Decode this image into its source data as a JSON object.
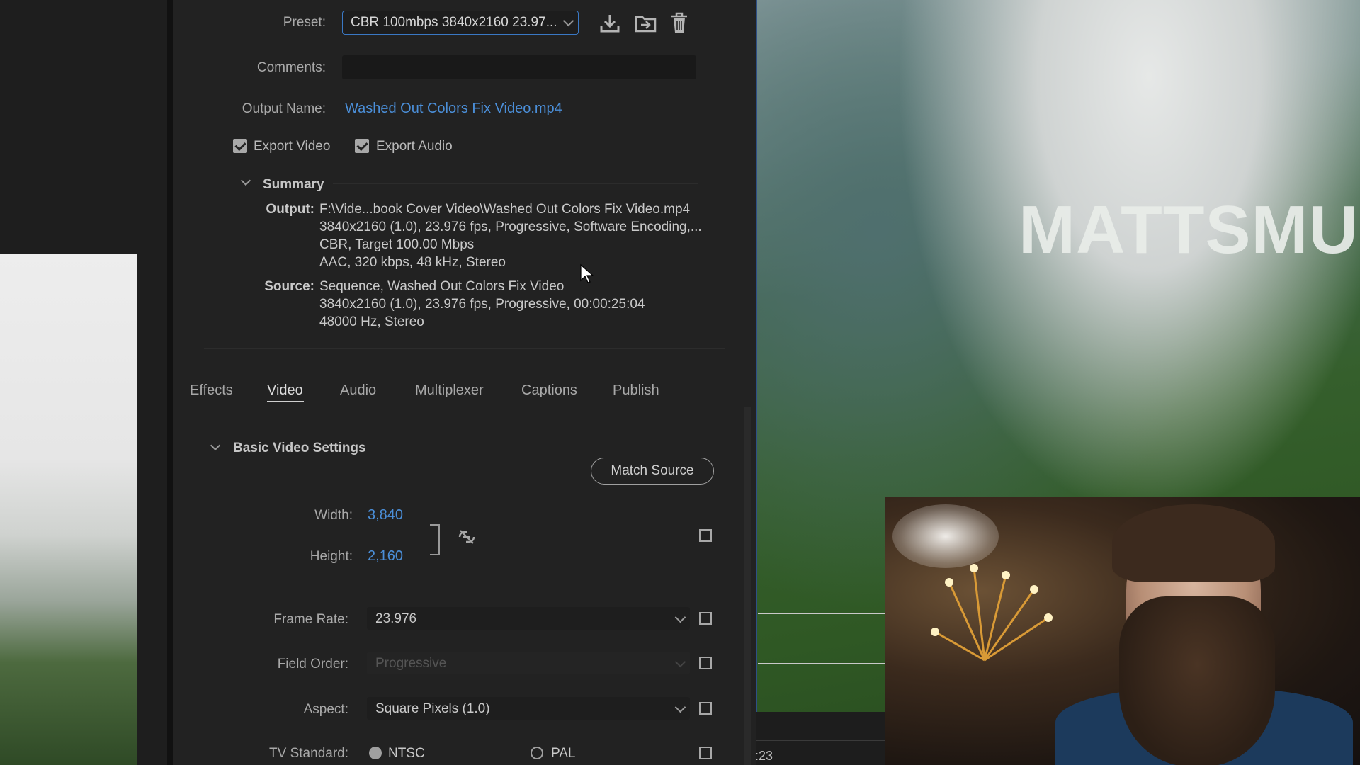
{
  "export_settings": {
    "preset_label": "Preset:",
    "preset_value": "CBR 100mbps 3840x2160 23.97...",
    "comments_label": "Comments:",
    "comments_value": "",
    "output_name_label": "Output Name:",
    "output_name_value": "Washed Out Colors Fix Video.mp4",
    "export_video_label": "Export Video",
    "export_audio_label": "Export Audio",
    "export_video_checked": true,
    "export_audio_checked": true
  },
  "summary": {
    "title": "Summary",
    "output_label": "Output:",
    "output_lines": [
      "F:\\Vide...book Cover Video\\Washed Out Colors Fix Video.mp4",
      "3840x2160 (1.0), 23.976 fps, Progressive, Software Encoding,...",
      "CBR, Target 100.00 Mbps",
      "AAC, 320 kbps, 48 kHz, Stereo"
    ],
    "source_label": "Source:",
    "source_lines": [
      "Sequence, Washed Out Colors Fix Video",
      "3840x2160 (1.0), 23.976 fps, Progressive, 00:00:25:04",
      "48000 Hz, Stereo"
    ]
  },
  "tabs": [
    "Effects",
    "Video",
    "Audio",
    "Multiplexer",
    "Captions",
    "Publish"
  ],
  "active_tab": "Video",
  "basic_video": {
    "title": "Basic Video Settings",
    "match_source_label": "Match Source",
    "width_label": "Width:",
    "width_value": "3,840",
    "height_label": "Height:",
    "height_value": "2,160",
    "frame_rate_label": "Frame Rate:",
    "frame_rate_value": "23.976",
    "field_order_label": "Field Order:",
    "field_order_value": "Progressive",
    "aspect_label": "Aspect:",
    "aspect_value": "Square Pixels (1.0)",
    "tv_standard_label": "TV Standard:",
    "ntsc_label": "NTSC",
    "pal_label": "PAL",
    "tv_standard_selected": "NTSC"
  },
  "preview": {
    "watermark_text": "MATTSMUS",
    "timecode": ":23"
  },
  "icons": {
    "save_preset": "download-icon",
    "import_preset": "import-folder-icon",
    "delete_preset": "trash-icon",
    "link_aspect": "unlink-icon"
  },
  "colors": {
    "accent_blue": "#4b8fd9",
    "panel_bg": "#222222"
  }
}
